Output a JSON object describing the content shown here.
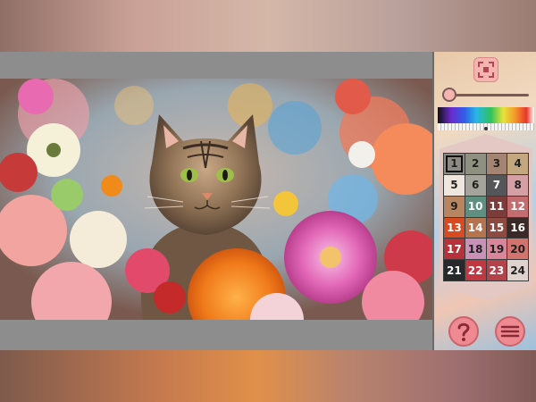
{
  "colors": {
    "stage_bg": "#8d8d8d",
    "accent_button": "#f08a92"
  },
  "icons": {
    "expand": "expand-icon",
    "help": "help-icon",
    "menu": "menu-icon"
  },
  "brush_size_slider": {
    "value": 0.0
  },
  "spectrum_marker": {
    "value": 0.5
  },
  "palette": {
    "selected": "1",
    "swatches": [
      {
        "number": "1",
        "color": "#8d8a83",
        "dark": false
      },
      {
        "number": "2",
        "color": "#8f9180",
        "dark": false
      },
      {
        "number": "3",
        "color": "#a48472",
        "dark": false
      },
      {
        "number": "4",
        "color": "#c2a77f",
        "dark": false
      },
      {
        "number": "5",
        "color": "#efe6de",
        "dark": false
      },
      {
        "number": "6",
        "color": "#a5a49a",
        "dark": false
      },
      {
        "number": "7",
        "color": "#53575a",
        "dark": true
      },
      {
        "number": "8",
        "color": "#d4a0a6",
        "dark": false
      },
      {
        "number": "9",
        "color": "#b7855f",
        "dark": false
      },
      {
        "number": "10",
        "color": "#5e8f80",
        "dark": true
      },
      {
        "number": "11",
        "color": "#7b3c3b",
        "dark": true
      },
      {
        "number": "12",
        "color": "#c46d70",
        "dark": true
      },
      {
        "number": "13",
        "color": "#d74a22",
        "dark": true
      },
      {
        "number": "14",
        "color": "#b5734e",
        "dark": true
      },
      {
        "number": "15",
        "color": "#8c4a40",
        "dark": true
      },
      {
        "number": "16",
        "color": "#3a2a27",
        "dark": true
      },
      {
        "number": "17",
        "color": "#b5323a",
        "dark": true
      },
      {
        "number": "18",
        "color": "#c991b8",
        "dark": false
      },
      {
        "number": "19",
        "color": "#d9869b",
        "dark": false
      },
      {
        "number": "20",
        "color": "#d2736e",
        "dark": false
      },
      {
        "number": "21",
        "color": "#27292a",
        "dark": true
      },
      {
        "number": "22",
        "color": "#c23842",
        "dark": true
      },
      {
        "number": "23",
        "color": "#b3424a",
        "dark": true
      },
      {
        "number": "24",
        "color": "#dfd3cf",
        "dark": false
      }
    ]
  }
}
